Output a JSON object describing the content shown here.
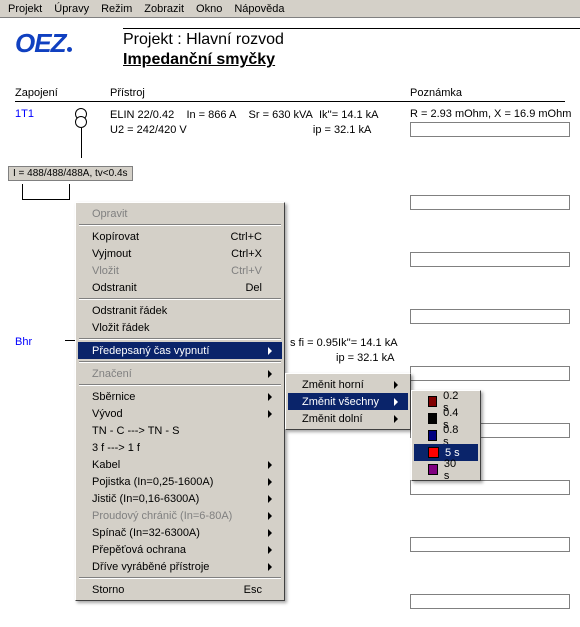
{
  "menubar": [
    "Projekt",
    "Úpravy",
    "Režim",
    "Zobrazit",
    "Okno",
    "Nápověda"
  ],
  "logo": "OEZ",
  "project_title": "Projekt : Hlavní rozvod",
  "page_title": "Impedanční smyčky",
  "col_headers": {
    "zap": "Zapojení",
    "prist": "Přístroj",
    "poz": "Poznámka"
  },
  "device1": {
    "id": "1T1",
    "spec1": "ELIN 22/0.42",
    "in": "In = 866 A",
    "sr": "Sr = 630 kVA",
    "ik": "Ik''= 14.1 kA",
    "u2": "U2 = 242/420 V",
    "ip": "ip = 32.1 kA",
    "remark": "R = 2.93 mOhm, X = 16.9 mOhm"
  },
  "current_label": "I = 488/488/488A, tv<0.4s",
  "device2": {
    "id": "Bhr",
    "fi": "s fi = 0.95",
    "ik": "Ik''= 14.1 kA",
    "ip": "ip = 32.1 kA"
  },
  "ctx1": {
    "opravit": "Opravit",
    "kopirovat": "Kopírovat",
    "sc_copy": "Ctrl+C",
    "vyjmout": "Vyjmout",
    "sc_cut": "Ctrl+X",
    "vlozit": "Vložit",
    "sc_paste": "Ctrl+V",
    "odstranit": "Odstranit",
    "sc_del": "Del",
    "odstranit_radek": "Odstranit řádek",
    "vlozit_radek": "Vložit řádek",
    "predepsany": "Předepsaný čas vypnutí",
    "znaceni": "Značení",
    "sbernice": "Sběrnice",
    "vyvod": "Vývod",
    "tnc": "TN - C  --->  TN - S",
    "ph": "3 f  --->  1 f",
    "kabel": "Kabel",
    "pojistka": "Pojistka (In=0,25-1600A)",
    "jistic": "Jistič (In=0,16-6300A)",
    "proud": "Proudový chránič (In=6-80A)",
    "spinac": "Spínač (In=32-6300A)",
    "prepetova": "Přepěťová ochrana",
    "drive": "Dříve vyráběné přístroje",
    "storno": "Storno",
    "sc_esc": "Esc"
  },
  "ctx2": {
    "horni": "Změnit horní",
    "vsechny": "Změnit všechny",
    "dolni": "Změnit dolní"
  },
  "ctx3": {
    "t02": "0.2 s",
    "t04": "0.4 s",
    "t08": "0.8 s",
    "t5": "5 s",
    "t30": "30 s"
  }
}
